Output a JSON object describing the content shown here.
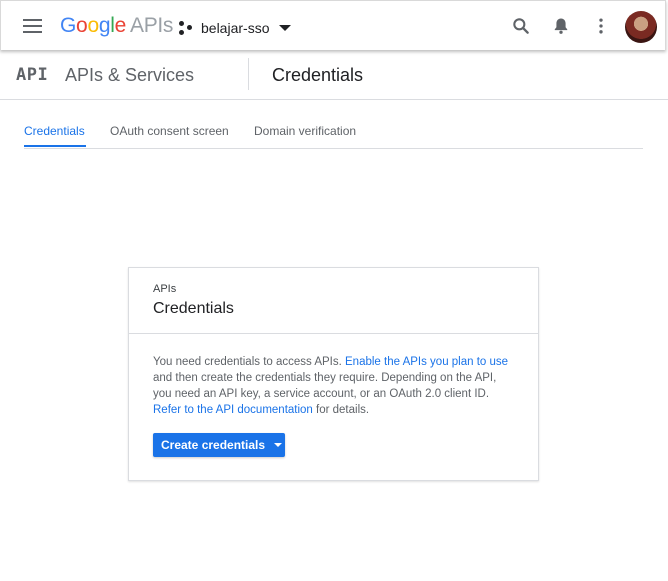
{
  "header": {
    "logo_letters": [
      {
        "ch": "G",
        "color": "#4285F4"
      },
      {
        "ch": "o",
        "color": "#EA4335"
      },
      {
        "ch": "o",
        "color": "#FBBC05"
      },
      {
        "ch": "g",
        "color": "#4285F4"
      },
      {
        "ch": "l",
        "color": "#34A853"
      },
      {
        "ch": "e",
        "color": "#EA4335"
      }
    ],
    "product": "APIs",
    "project_name": "belajar-sso",
    "icons": [
      "menu-icon",
      "project-icon",
      "search-icon",
      "notifications-icon",
      "more-vert-icon",
      "avatar"
    ]
  },
  "subheader": {
    "mark": "API",
    "section": "APIs & Services",
    "page_title": "Credentials"
  },
  "tabs": [
    {
      "label": "Credentials",
      "active": true
    },
    {
      "label": "OAuth consent screen",
      "active": false
    },
    {
      "label": "Domain verification",
      "active": false
    }
  ],
  "card": {
    "kicker": "APIs",
    "title": "Credentials",
    "body": {
      "p1": "You need credentials to access APIs. ",
      "link1": "Enable the APIs you plan to use",
      "p2": " and then create the credentials they require. Depending on the API, you need an API key, a service account, or an OAuth 2.0 client ID. ",
      "link2": "Refer to the API documentation",
      "p3": " for details."
    },
    "button_label": "Create credentials"
  },
  "colors": {
    "accent": "#1a73e8",
    "text_primary": "#202124",
    "text_secondary": "#5f6368",
    "divider": "#dadce0"
  }
}
